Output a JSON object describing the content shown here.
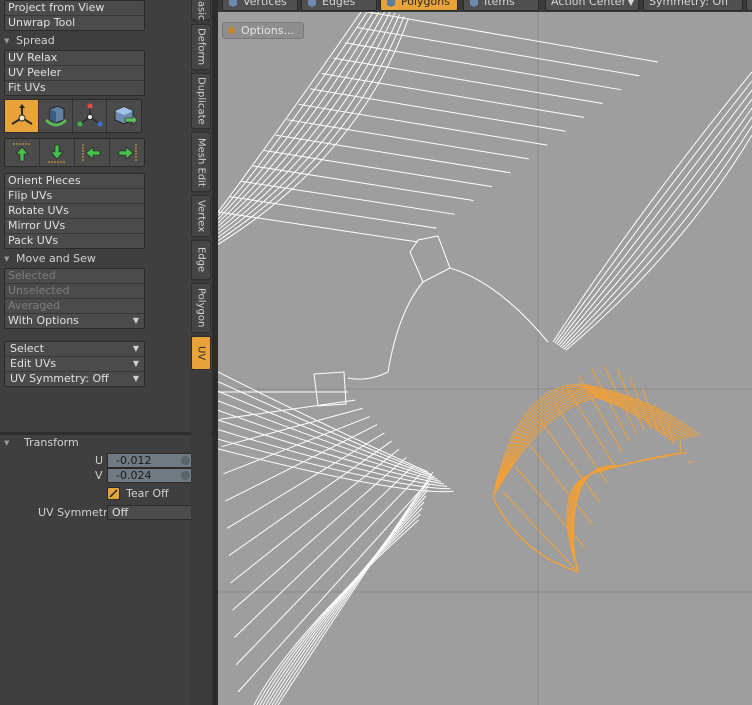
{
  "uv_tools": {
    "top_group": [
      "Project from View",
      "Unwrap Tool"
    ],
    "spread_header": "Spread",
    "spread_group": [
      "UV Relax",
      "UV Peeler",
      "Fit UVs"
    ],
    "orient_group": [
      "Orient Pieces",
      "Flip UVs",
      "Rotate UVs",
      "Mirror UVs",
      "Pack UVs"
    ],
    "move_sew_header": "Move and Sew",
    "move_sew_group": [
      "Selected",
      "Unselected",
      "Averaged"
    ],
    "with_options": "With Options",
    "select_dd": "Select",
    "edit_uvs_dd": "Edit UVs",
    "uv_symmetry_dd": "UV Symmetry: Off"
  },
  "vertical_tabs": [
    "Basic",
    "Deform",
    "Duplicate",
    "Mesh Edit",
    "Vertex",
    "Edge",
    "Polygon",
    "UV"
  ],
  "active_tab": "UV",
  "transform": {
    "header": "Transform",
    "u_label": "U",
    "u_value": "-0.012",
    "v_label": "V",
    "v_value": "-0.024",
    "tear_off": "Tear Off",
    "tear_off_checked": true,
    "uv_symmetry_label": "UV Symmetry",
    "uv_symmetry_value": "Off"
  },
  "toolbar": {
    "vertices": "Vertices",
    "edges": "Edges",
    "polygons": "Polygons",
    "items": "Items",
    "action_center": "Action Center",
    "symmetry": "Symmetry: Off",
    "active_mode": "Polygons"
  },
  "viewport": {
    "options_label": "Options...",
    "accent": "#f2a035",
    "background": "#9e9e9e",
    "wire": "#ffffff"
  }
}
